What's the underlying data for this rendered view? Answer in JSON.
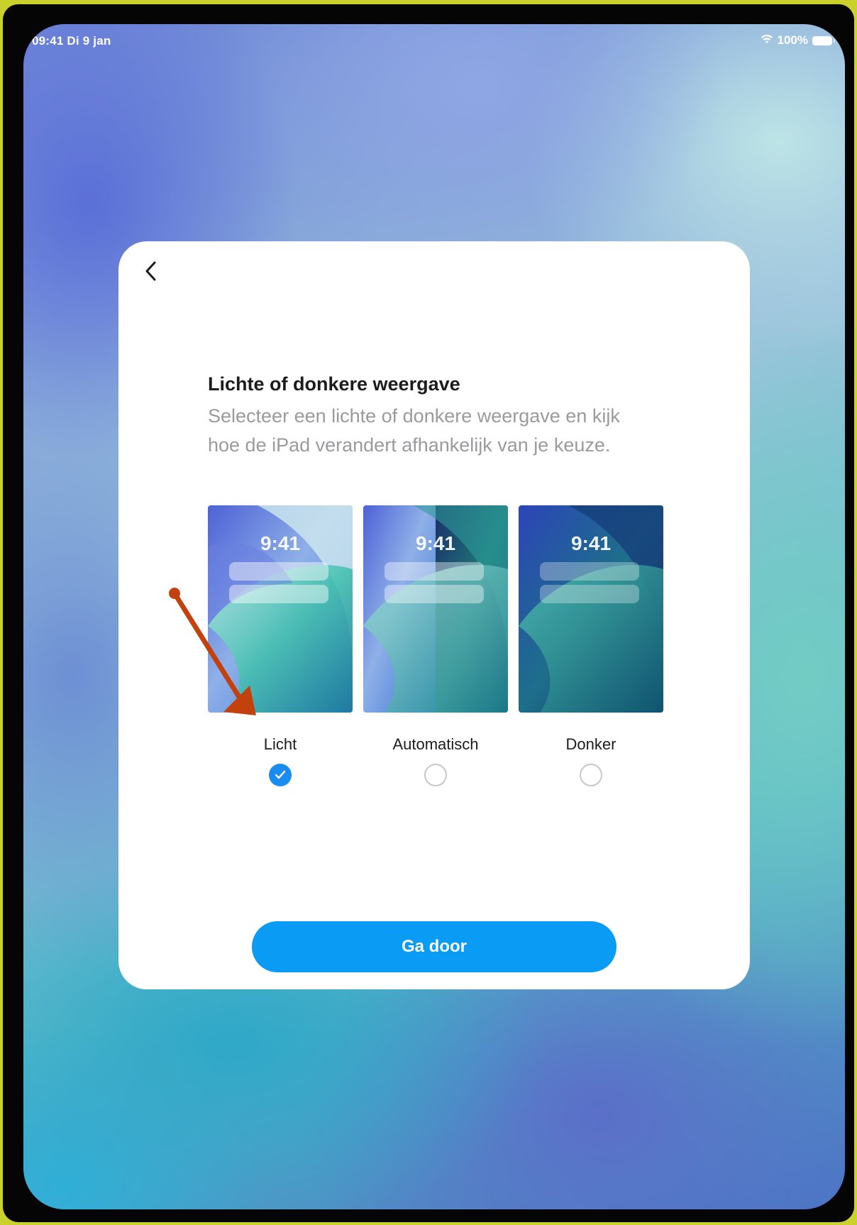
{
  "status_bar": {
    "time_date": "09:41  Di 9 jan",
    "battery": "100%"
  },
  "dialog": {
    "title": "Lichte of donkere weergave",
    "subtitle": "Selecteer een lichte of donkere weergave en kijk hoe de iPad verandert afhankelijk van je keuze.",
    "options": [
      {
        "label": "Licht",
        "preview_time": "9:41",
        "selected": true
      },
      {
        "label": "Automatisch",
        "preview_time": "9:41",
        "selected": false
      },
      {
        "label": "Donker",
        "preview_time": "9:41",
        "selected": false
      }
    ],
    "continue_label": "Ga door"
  },
  "colors": {
    "accent": "#0a9bf4",
    "radio_selected": "#1a8cf0",
    "annotation_arrow": "#c2410c"
  },
  "icons": {
    "back": "chevron-left-icon",
    "wifi": "wifi-icon",
    "battery": "battery-icon",
    "check": "checkmark-icon"
  }
}
